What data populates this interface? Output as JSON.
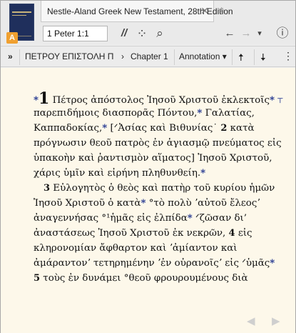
{
  "tab": {
    "title": "Nestle-Aland Greek New Testament, 28th Edition",
    "close": "✕",
    "add": "+"
  },
  "badge": "A",
  "toolbar": {
    "reference_value": "1 Peter 1:1",
    "parallel_icon": "//",
    "visual_filter_icon": "⁘",
    "search_icon": "⌕",
    "back_icon": "←",
    "forward_icon": "→",
    "dropdown_icon": "▾",
    "info_icon": "ⓘ"
  },
  "nav": {
    "expand_icon": "»",
    "book": "ΠΕΤΡΟΥ ΕΠΙΣΤΟΛΗ Π",
    "chevron": "›",
    "chapter": "Chapter 1",
    "annotation": "Annotation ▾",
    "up_icon": "🠅",
    "down_icon": "🠇",
    "more_icon": "⋮"
  },
  "text_lines": [
    {
      "pre_star": "*",
      "num": "1",
      "text": " Πέτρος ἀπόστολος Ἰησοῦ Χριστοῦ ἐκλεκτοῖς",
      "post": "*",
      "mark": " ⊤"
    },
    {
      "text": "παρεπιδήμοις διασπορᾶς Πόντου,",
      "post": "*",
      "tail": " Γαλατίας,"
    },
    {
      "text": "Καππαδοκίας,",
      "post": "*",
      "tail": " [ᐟἈσίας καὶ Βιθυνίας˙  ",
      "vnum": "2",
      "tail2": " κατὰ"
    },
    {
      "text": "πρόγνωσιν θεοῦ πατρὸς ἐν ἁγιασμῷ πνεύματος εἰς"
    },
    {
      "text": "ὑπακοὴν καὶ ῥαντισμὸν αἵματος] Ἰησοῦ Χριστοῦ,"
    },
    {
      "text": "χάρις ὑμῖν καὶ εἰρήνη πληθυνθείη.",
      "post": "*"
    },
    {
      "vnum": "3",
      "text": " Εὐλογητὸς ὁ θεὸς καὶ πατὴρ τοῦ κυρίου ἡμῶν",
      "indent": true
    },
    {
      "text": "Ἰησοῦ Χριστοῦ ὁ κατὰ",
      "post": "*",
      "tail": " °τὸ πολὺ ʼαὐτοῦ ἔλεοςʼ"
    },
    {
      "text": "ἀναγεννήσας °¹ἡμᾶς εἰς ἐλπίδα",
      "post": "*",
      "tail": " ᐟζῶσαν δι’"
    },
    {
      "text": "ἀναστάσεως Ἰησοῦ Χριστοῦ ἐκ νεκρῶν, ",
      "vnum": "4",
      "tail": " εἰς"
    },
    {
      "text": "κληρονομίαν ἄφθαρτον καὶ ʼἀμίαντον καὶ"
    },
    {
      "text": "ἀμάραντονʼ τετηρημένην ʼἐν οὐρανοῖςʼ εἰς ᐟὑμᾶς",
      "post": "*"
    },
    {
      "vnum": "5",
      "text": " τοὺς ἐν δυνάμει °θεοῦ φρουρουμένους διὰ"
    }
  ],
  "pager": {
    "prev": "◀",
    "next": "▶"
  },
  "colors": {
    "content_bg": "#fdf8ea",
    "star": "#1a2f8c",
    "badge": "#f0a030"
  }
}
